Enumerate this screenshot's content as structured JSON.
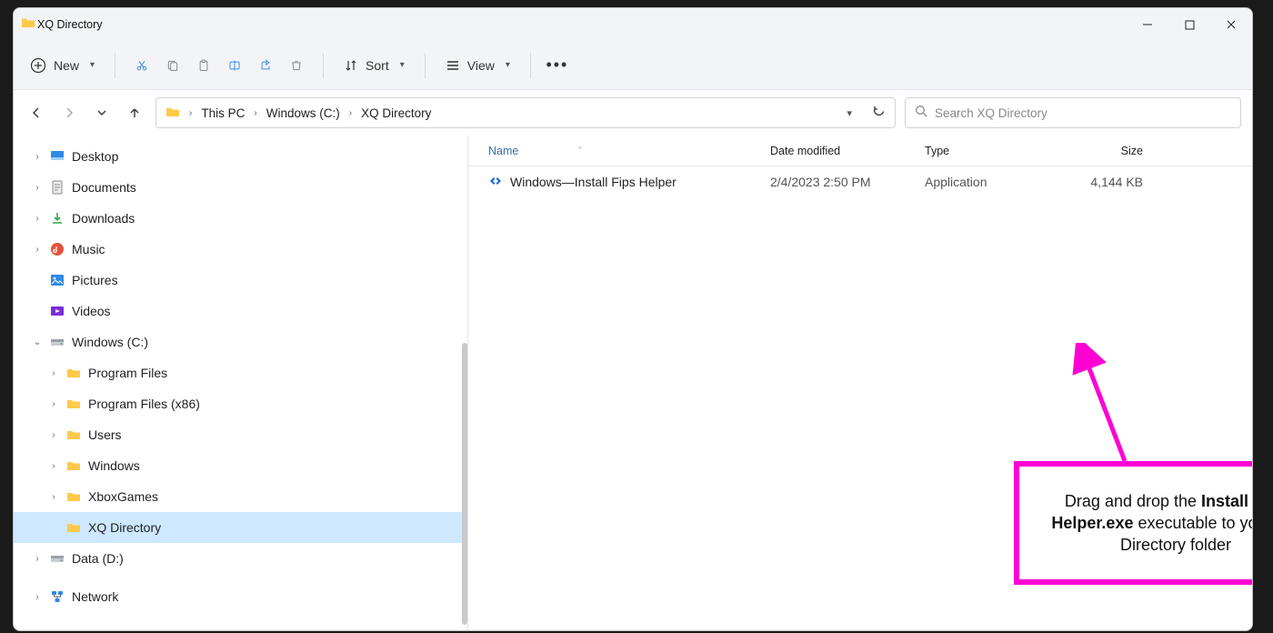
{
  "window": {
    "title": "XQ Directory",
    "min_tooltip": "Minimize",
    "max_tooltip": "Maximize",
    "close_tooltip": "Close"
  },
  "toolbar": {
    "new_label": "New",
    "sort_label": "Sort",
    "view_label": "View"
  },
  "breadcrumb": {
    "root": "This PC",
    "drive": "Windows (C:)",
    "folder": "XQ Directory"
  },
  "search": {
    "placeholder": "Search XQ Directory"
  },
  "tree": [
    {
      "level": 0,
      "label": "Desktop",
      "icon": "desktop",
      "chev": ">"
    },
    {
      "level": 0,
      "label": "Documents",
      "icon": "doc",
      "chev": ">"
    },
    {
      "level": 0,
      "label": "Downloads",
      "icon": "download",
      "chev": ">"
    },
    {
      "level": 0,
      "label": "Music",
      "icon": "music",
      "chev": ">"
    },
    {
      "level": 0,
      "label": "Pictures",
      "icon": "picture",
      "chev": ""
    },
    {
      "level": 0,
      "label": "Videos",
      "icon": "video",
      "chev": ""
    },
    {
      "level": 0,
      "label": "Windows (C:)",
      "icon": "drive",
      "chev": "v"
    },
    {
      "level": 1,
      "label": "Program Files",
      "icon": "folder",
      "chev": ">"
    },
    {
      "level": 1,
      "label": "Program Files (x86)",
      "icon": "folder",
      "chev": ">"
    },
    {
      "level": 1,
      "label": "Users",
      "icon": "folder",
      "chev": ">"
    },
    {
      "level": 1,
      "label": "Windows",
      "icon": "folder",
      "chev": ">"
    },
    {
      "level": 1,
      "label": "XboxGames",
      "icon": "folder",
      "chev": ">"
    },
    {
      "level": 1,
      "label": "XQ Directory",
      "icon": "folder",
      "chev": "",
      "selected": true
    },
    {
      "level": 0,
      "label": "Data (D:)",
      "icon": "drive",
      "chev": ">"
    },
    {
      "level": 0,
      "label": "Network",
      "icon": "network",
      "chev": ">",
      "spaced": true
    }
  ],
  "columns": {
    "name": "Name",
    "date": "Date modified",
    "type": "Type",
    "size": "Size"
  },
  "files": [
    {
      "name": "Windows—Install Fips Helper",
      "date": "2/4/2023 2:50 PM",
      "type": "Application",
      "size": "4,144 KB"
    }
  ],
  "callout": {
    "prefix": "Drag and drop the ",
    "bold": "Install Fips Helper.exe",
    "suffix": " executable to your XQ Directory folder"
  }
}
